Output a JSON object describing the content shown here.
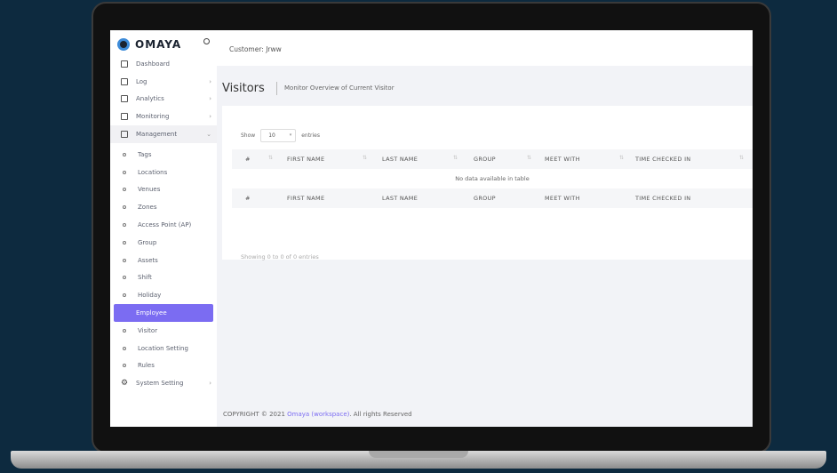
{
  "brand": {
    "name": "OMAYA"
  },
  "header": {
    "customer": "Customer: Jrww"
  },
  "sidebar": {
    "items": [
      {
        "label": "Dashboard",
        "type": "parent",
        "chevron": ""
      },
      {
        "label": "Log",
        "type": "parent",
        "chevron": "›"
      },
      {
        "label": "Analytics",
        "type": "parent",
        "chevron": "›"
      },
      {
        "label": "Monitoring",
        "type": "parent",
        "chevron": "›"
      },
      {
        "label": "Management",
        "type": "open",
        "chevron": "⌄"
      },
      {
        "label": "Tags",
        "type": "sub"
      },
      {
        "label": "Locations",
        "type": "sub"
      },
      {
        "label": "Venues",
        "type": "sub"
      },
      {
        "label": "Zones",
        "type": "sub"
      },
      {
        "label": "Access Point (AP)",
        "type": "sub"
      },
      {
        "label": "Group",
        "type": "sub"
      },
      {
        "label": "Assets",
        "type": "sub"
      },
      {
        "label": "Shift",
        "type": "sub"
      },
      {
        "label": "Holiday",
        "type": "sub"
      },
      {
        "label": "Employee",
        "type": "active"
      },
      {
        "label": "Visitor",
        "type": "sub"
      },
      {
        "label": "Location Setting",
        "type": "sub"
      },
      {
        "label": "Rules",
        "type": "sub"
      },
      {
        "label": "System Setting",
        "type": "parent",
        "chevron": "›"
      }
    ]
  },
  "page": {
    "title": "Visitors",
    "subtitle": "Monitor Overview of Current Visitor"
  },
  "table": {
    "show_label": "Show",
    "entries_value": "10",
    "entries_label": "entries",
    "columns": [
      "#",
      "FIRST NAME",
      "LAST NAME",
      "GROUP",
      "MEET WITH",
      "TIME CHECKED IN"
    ],
    "empty_message": "No data available in table",
    "info": "Showing 0 to 0 of 0 entries"
  },
  "footer": {
    "prefix": "COPYRIGHT © 2021",
    "link": "Omaya (workspace)",
    "suffix": ". All rights Reserved"
  },
  "colors": {
    "accent": "#7b6cf2",
    "background": "#0d2a3f"
  }
}
